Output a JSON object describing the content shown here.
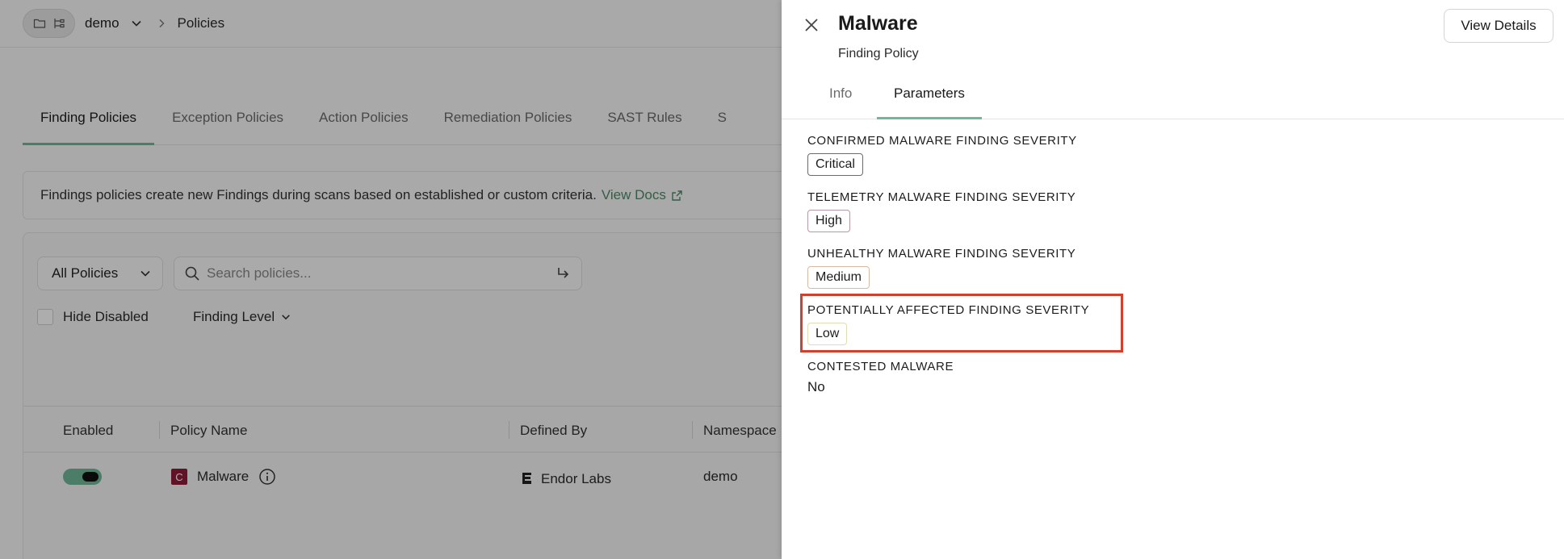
{
  "topbar": {
    "project": "demo",
    "breadcrumb": "Policies"
  },
  "tabs": [
    "Finding Policies",
    "Exception Policies",
    "Action Policies",
    "Remediation Policies",
    "SAST Rules",
    "S"
  ],
  "info": {
    "text": "Findings policies create new Findings during scans based on established or custom criteria.",
    "link": "View Docs"
  },
  "filters": {
    "select_value": "All Policies",
    "search_placeholder": "Search policies...",
    "hide_disabled": "Hide Disabled",
    "finding_level": "Finding Level"
  },
  "table": {
    "headers": [
      "Enabled",
      "Policy Name",
      "Defined By",
      "Namespace"
    ],
    "rows": [
      {
        "enabled": true,
        "badge": "C",
        "name": "Malware",
        "defined_by": "Endor Labs",
        "namespace": "demo"
      }
    ]
  },
  "drawer": {
    "title": "Malware",
    "subtitle": "Finding Policy",
    "view_details": "View Details",
    "tabs": [
      "Info",
      "Parameters"
    ],
    "active_tab": "Parameters",
    "parameters": [
      {
        "label": "CONFIRMED MALWARE FINDING SEVERITY",
        "value": "Critical"
      },
      {
        "label": "TELEMETRY MALWARE FINDING SEVERITY",
        "value": "High"
      },
      {
        "label": "UNHEALTHY MALWARE FINDING SEVERITY",
        "value": "Medium"
      },
      {
        "label": "POTENTIALLY AFFECTED FINDING SEVERITY",
        "value": "Low"
      },
      {
        "label": "CONTESTED MALWARE",
        "value": "No"
      }
    ]
  },
  "colors": {
    "accent": "#6fb89a",
    "link": "#4f8a68",
    "highlight": "#d43e2c",
    "critical_badge": "#8e1d3a"
  }
}
